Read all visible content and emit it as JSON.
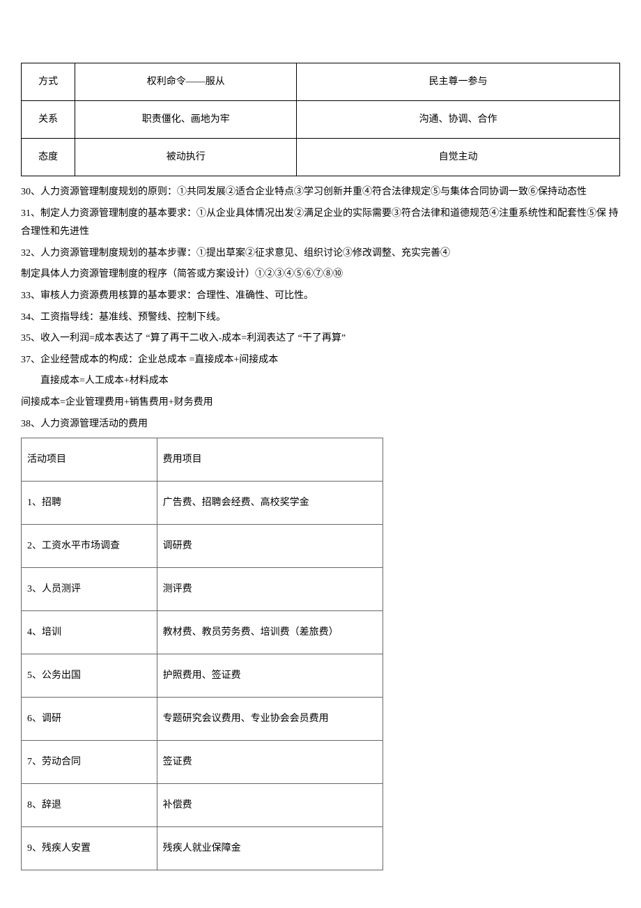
{
  "topTable": {
    "rows": [
      {
        "c1": "方式",
        "c2": "权利命令——服从",
        "c3": "民主尊一参与"
      },
      {
        "c1": "关系",
        "c2": "职责僵化、画地为牢",
        "c3": "沟通、协调、合作"
      },
      {
        "c1": "态度",
        "c2": "被动执行",
        "c3": "自觉主动"
      }
    ]
  },
  "paragraphs": {
    "p30": "30、人力资源管理制度规划的原则：①共同发展②适合企业特点③学习创新并重④符合法律规定⑤与集体合同协调一致⑥保持动态性",
    "p31": "31、制定人力资源管理制度的基本要求：①从企业具体情况出发②满足企业的实际需要③符合法律和道德规范④注重系统性和配套性⑤保 持合理性和先进性",
    "p32": "32、人力资源管理制度规划的基本步骤：①提出草案②征求意见、组织讨论③修改调整、充实完善④",
    "p32b": "制定具体人力资源管理制度的程序（简答或方案设计）①②③④⑤⑥⑦⑧⑩",
    "p33": "33、审核人力资源费用核算的基本要求：合理性、准确性、可比性。",
    "p34": "34、工资指导线：基准线、预警线、控制下线。",
    "p35": "35、收入一利润=成本表达了 “算了再干二收入-成本=利润表达了 “干了再算”",
    "p37": "37、企业经营成本的构成：企业总成本 =直接成本+间接成本",
    "p37a": "直接成本=人工成本+材料成本",
    "p37b": "间接成本=企业管理费用+销售费用+财务费用",
    "p38": "38、人力资源管理活动的费用"
  },
  "itemsTable": {
    "header": {
      "c1": "活动项目",
      "c2": "费用项目"
    },
    "rows": [
      {
        "c1": "1、招聘",
        "c2": "广告费、招聘会经费、高校奖学金"
      },
      {
        "c1": "2、工资水平市场调查",
        "c2": "调研费"
      },
      {
        "c1": "3、人员测评",
        "c2": "测评费"
      },
      {
        "c1": "4、培训",
        "c2": "教材费、教员劳务费、培训费（差旅费）"
      },
      {
        "c1": "5、公务出国",
        "c2": "护照费用、签证费"
      },
      {
        "c1": "6、调研",
        "c2": "专题研究会议费用、专业协会会员费用"
      },
      {
        "c1": "7、劳动合同",
        "c2": "签证费"
      },
      {
        "c1": "8、辞退",
        "c2": "补偿费"
      },
      {
        "c1": "9、残疾人安置",
        "c2": "残疾人就业保障金"
      }
    ]
  }
}
